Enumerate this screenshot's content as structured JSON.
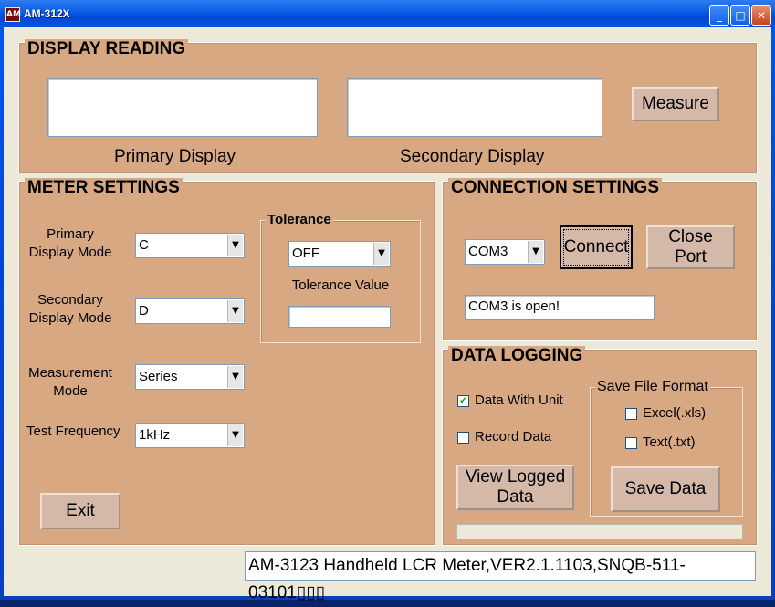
{
  "window": {
    "title": "AM-312X",
    "app_icon": "AM",
    "minimize_glyph": "_",
    "maximize_glyph": "□",
    "close_glyph": "✕"
  },
  "display_reading": {
    "group_title": "DISPLAY READING",
    "primary_value": "",
    "secondary_value": "",
    "primary_label": "Primary Display",
    "secondary_label": "Secondary Display",
    "measure_button": "Measure"
  },
  "meter_settings": {
    "group_title": "METER SETTINGS",
    "primary_mode_label": "Primary\nDisplay Mode",
    "primary_mode_value": "C",
    "secondary_mode_label": "Secondary\nDisplay Mode",
    "secondary_mode_value": "D",
    "measurement_mode_label": "Measurement\nMode",
    "measurement_mode_value": "Series",
    "test_frequency_label": "Test Frequency",
    "test_frequency_value": "1kHz",
    "exit_button": "Exit",
    "tolerance": {
      "title": "Tolerance",
      "value": "OFF",
      "tolerance_value_label": "Tolerance Value",
      "tolerance_value_input": ""
    }
  },
  "connection_settings": {
    "group_title": "CONNECTION SETTINGS",
    "port_value": "COM3",
    "connect_button": "Connect",
    "close_port_button": "Close\nPort",
    "status_text": "COM3 is open!"
  },
  "data_logging": {
    "group_title": "DATA LOGGING",
    "data_with_unit_label": "Data With Unit",
    "data_with_unit_checked": true,
    "record_data_label": "Record Data",
    "record_data_checked": false,
    "view_logged_button": "View Logged\nData",
    "save_format": {
      "title": "Save File Format",
      "excel_label": "Excel(.xls)",
      "excel_checked": false,
      "text_label": "Text(.txt)",
      "text_checked": false,
      "save_button": "Save Data"
    },
    "progress": 0
  },
  "status_bar": {
    "device_info": "AM-3123 Handheld LCR Meter,VER2.1.1103,SNQB-511-03101▯▯▯"
  },
  "icons": {
    "dropdown_arrow": "▼",
    "check_mark": "✔"
  }
}
